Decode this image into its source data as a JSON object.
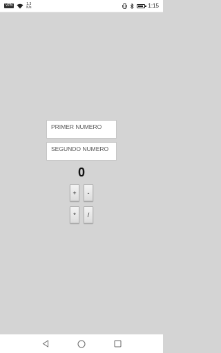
{
  "status_bar": {
    "vpn_label": "VPN",
    "speed_value": "1.3",
    "speed_unit": "K/s",
    "time": "1:15"
  },
  "form": {
    "first_placeholder": "PRIMER NUMERO",
    "second_placeholder": "SEGUNDO NUMERO"
  },
  "result": "0",
  "operators": {
    "add": "+",
    "subtract": "-",
    "multiply": "*",
    "divide": "/"
  },
  "nav": {
    "back_icon": "triangle-back-icon",
    "home_icon": "circle-home-icon",
    "recents_icon": "square-recents-icon"
  }
}
